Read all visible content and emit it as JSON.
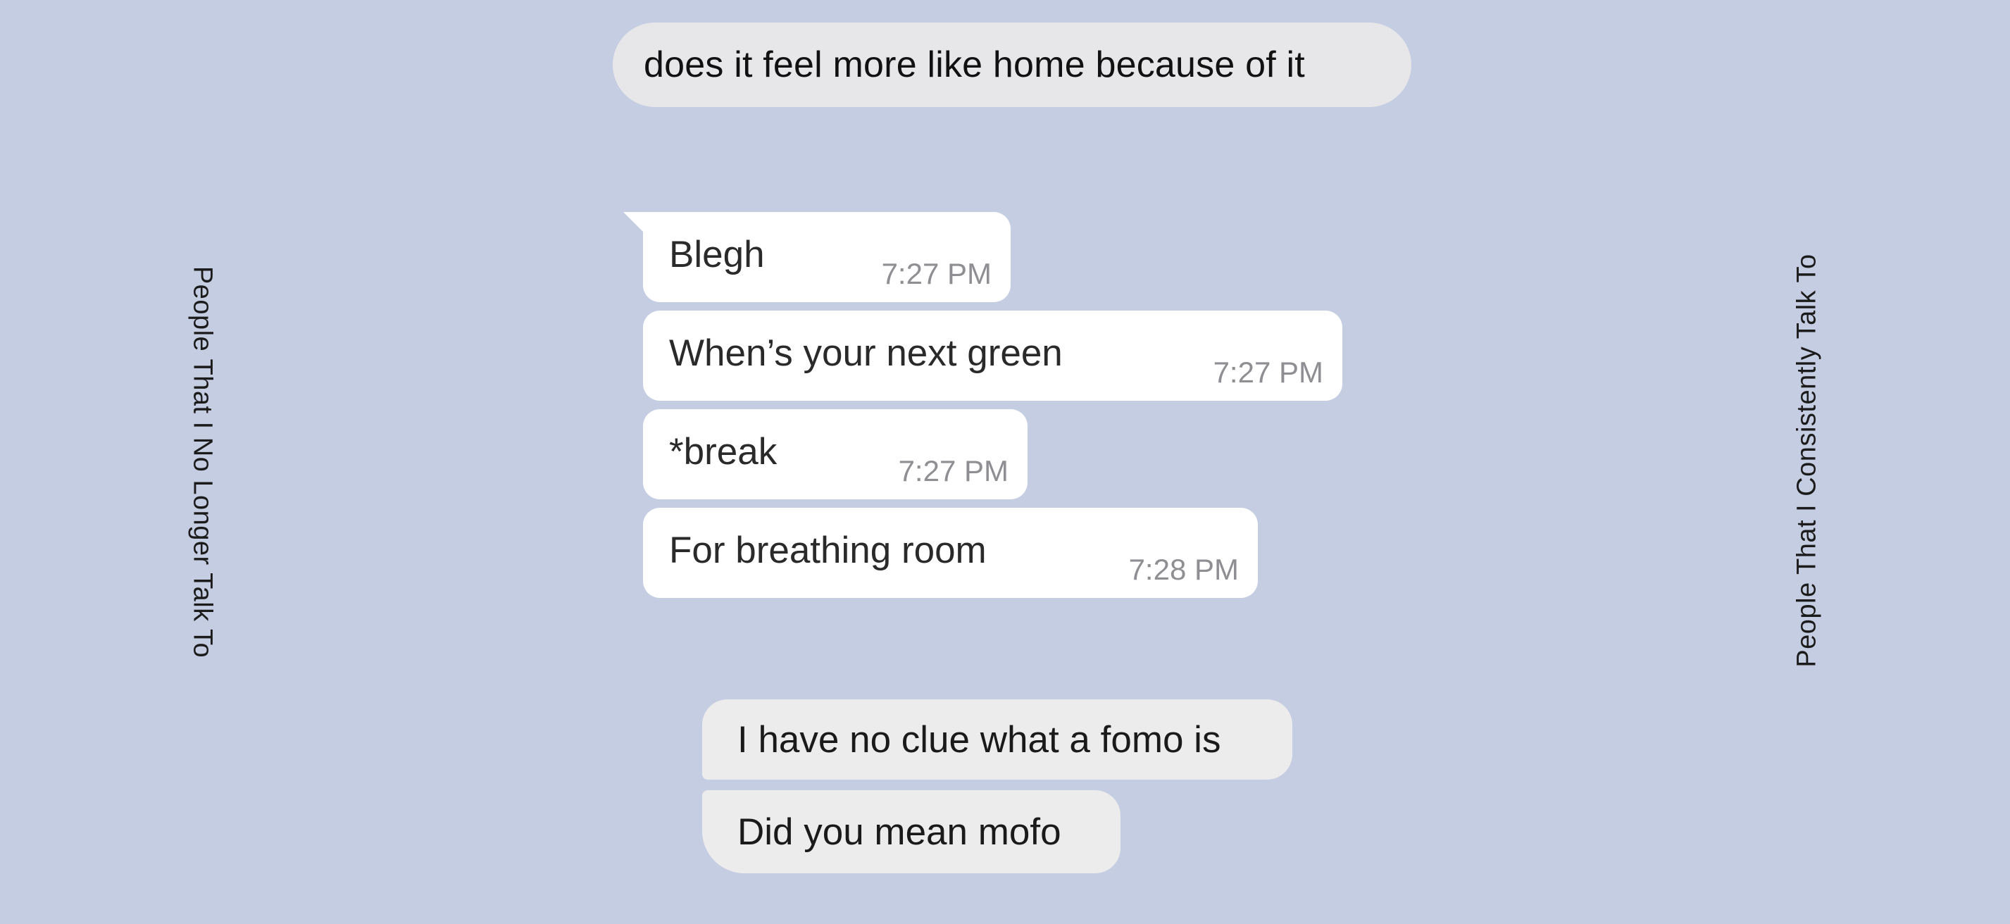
{
  "side_labels": {
    "left": "People That I No Longer Talk To",
    "right": "People That I Consistently Talk To"
  },
  "top_message": {
    "text": "does it feel more like home because of it"
  },
  "telegram_messages": [
    {
      "text": "Blegh",
      "time": "7:27 PM"
    },
    {
      "text": "When’s your next green",
      "time": "7:27 PM"
    },
    {
      "text": "*break",
      "time": "7:27 PM"
    },
    {
      "text": "For breathing room",
      "time": "7:28 PM"
    }
  ],
  "imessages": [
    {
      "text": "I have no clue what a fomo is"
    },
    {
      "text": "Did you mean mofo"
    }
  ],
  "colors": {
    "background": "#c5cde2",
    "gray_bubble": "#ececec",
    "white_bubble": "#ffffff",
    "timestamp": "#8e8e93"
  }
}
